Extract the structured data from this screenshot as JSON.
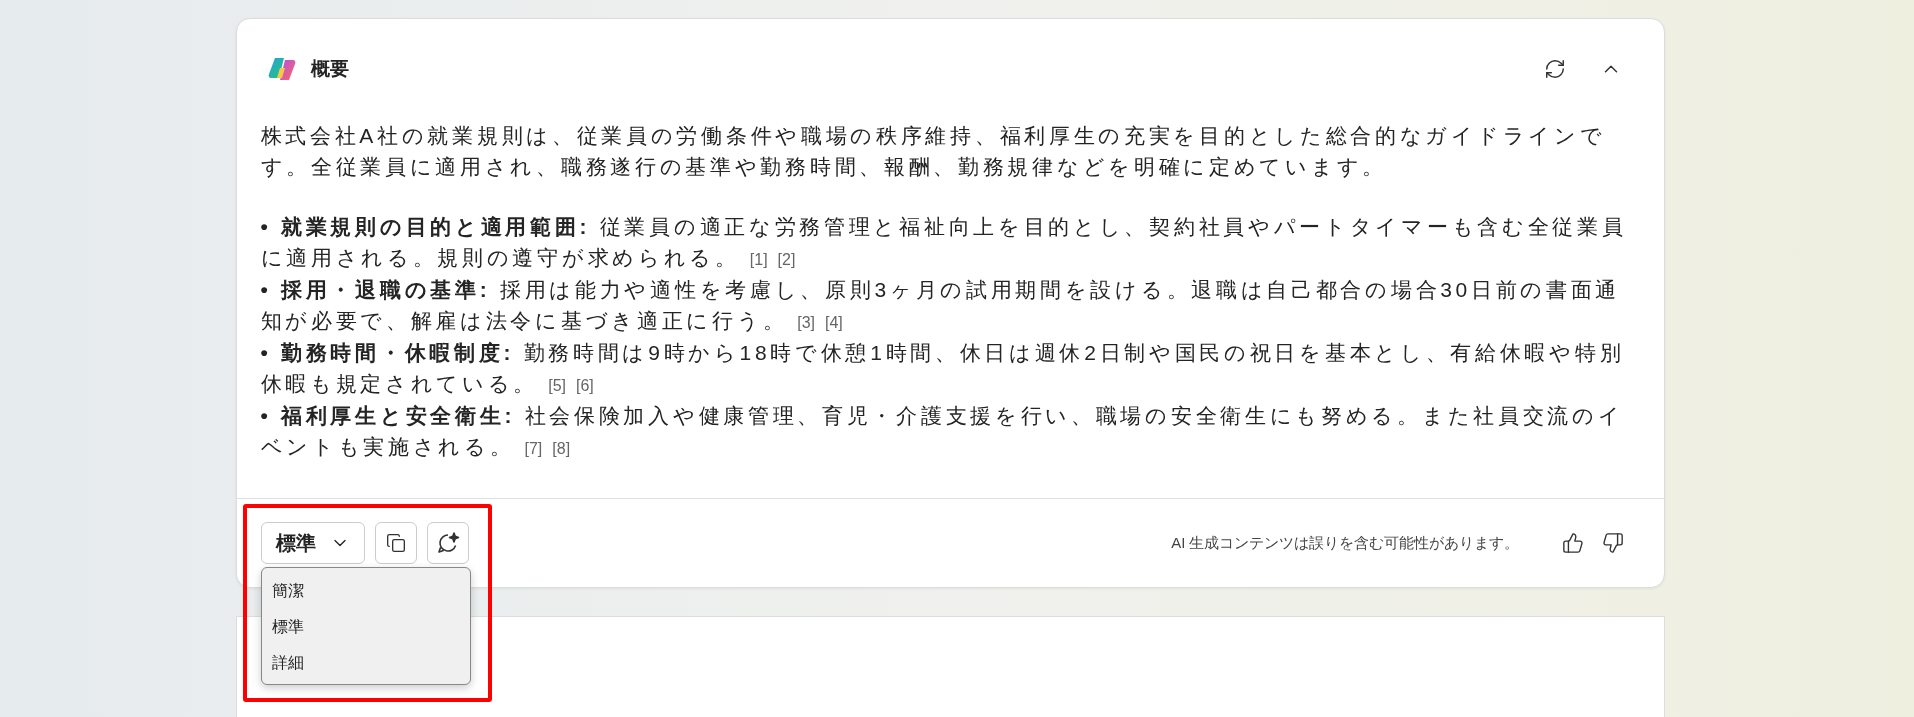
{
  "card": {
    "title": "概要",
    "summary": "株式会社A社の就業規則は、従業員の労働条件や職場の秩序維持、福利厚生の充実を目的とした総合的なガイドラインです。全従業員に適用され、職務遂行の基準や勤務時間、報酬、勤務規律などを明確に定めています。",
    "bullets": [
      {
        "text": "**• 就業規則の目的と適用範囲:** 従業員の適正な労務管理と福祉向上を目的とし、契約社員やパートタイマーも含む全従業員に適用される。規則の遵守が求められる。",
        "citations": [
          "[1]",
          "[2]"
        ]
      },
      {
        "text": "**• 採用・退職の基準:** 採用は能力や適性を考慮し、原則3ヶ月の試用期間を設ける。退職は自己都合の場合30日前の書面通知が必要で、解雇は法令に基づき適正に行う。",
        "citations": [
          "[3]",
          "[4]"
        ]
      },
      {
        "text": "**• 勤務時間・休暇制度:** 勤務時間は9時から18時で休憩1時間、休日は週休2日制や国民の祝日を基本とし、有給休暇や特別休暇も規定されている。",
        "citations": [
          "[5]",
          "[6]"
        ]
      },
      {
        "text": "**• 福利厚生と安全衛生:** 社会保険加入や健康管理、育児・介護支援を行い、職場の安全衛生にも努める。また社員交流のイベントも実施される。",
        "citations": [
          "[7]",
          "[8]"
        ]
      }
    ],
    "footer": {
      "length_select": {
        "value": "標準",
        "expanded": true,
        "options": [
          "簡潔",
          "標準",
          "詳細"
        ]
      },
      "disclaimer": "AI 生成コンテンツは誤りを含む可能性があります。"
    }
  },
  "highlight": {
    "visible": true,
    "color": "#ff0000"
  }
}
